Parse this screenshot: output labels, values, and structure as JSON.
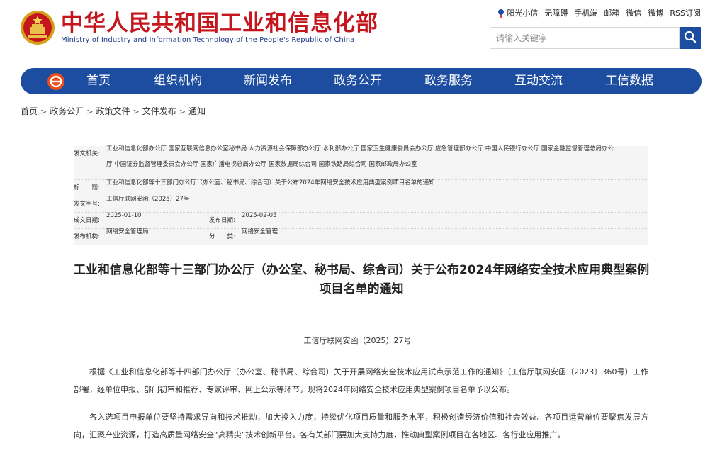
{
  "header": {
    "title_cn": "中华人民共和国工业和信息化部",
    "title_en": "Ministry of Industry and Information Technology of the People's Republic of China"
  },
  "top_links": [
    "阳光小信",
    "无障碍",
    "手机端",
    "邮箱",
    "微信",
    "微博",
    "RSS订阅"
  ],
  "search": {
    "placeholder": "请输入关键字"
  },
  "nav": {
    "items": [
      "首页",
      "组织机构",
      "新闻发布",
      "政务公开",
      "政务服务",
      "互动交流",
      "工信数据"
    ]
  },
  "breadcrumb": [
    "首页",
    "政务公开",
    "政策文件",
    "文件发布",
    "通知"
  ],
  "info": {
    "issuer_label": "发文机关:",
    "issuer_line1": "工业和信息化部办公厅 国家互联网信息办公室秘书局 人力资源社会保障部办公厅 水利部办公厅 国家卫生健康委员会办公厅 应急管理部办公厅 中国人民银行办公厅 国家金融监督管理总局办公",
    "issuer_line2": "厅 中国证券监督管理委员会办公厅 国家广播电视总局办公厅 国家数据局综合司 国家铁路局综合司 国家邮政局办公室",
    "title_label": "标　　题:",
    "title_value": "工业和信息化部等十三部门办公厅（办公室、秘书局、综合司）关于公布2024年网络安全技术应用典型案例项目名单的通知",
    "docno_label": "发文字号:",
    "docno_value": "工信厅联网安函（2025）27号",
    "created_label": "成文日期:",
    "created_value": "2025-01-10",
    "published_label": "发布日期:",
    "published_value": "2025-02-05",
    "org_label": "发布机构:",
    "org_value": "网络安全管理局",
    "category_label": "分　　类:",
    "category_value": "网络安全管理"
  },
  "article": {
    "title": "工业和信息化部等十三部门办公厅（办公室、秘书局、综合司）关于公布2024年网络安全技术应用典型案例项目名单的通知",
    "doc_number": "工信厅联网安函（2025）27号",
    "para1": "根据《工业和信息化部等十四部门办公厅（办公室、秘书局、综合司）关于开展网络安全技术应用试点示范工作的通知》（工信厅联网安函〔2023〕360号）工作部署，经单位申报、部门初审和推荐、专家评审、网上公示等环节，现将2024年网络安全技术应用典型案例项目名单予以公布。",
    "para2": "各入选项目申报单位要坚持需求导向和技术推动，加大投入力度，持续优化项目质量和服务水平，积极创造经济价值和社会效益。各项目运营单位要聚焦发展方向，汇聚产业资源，打造高质量网络安全“高精尖”技术创新平台。各有关部门要加大支持力度，推动典型案例项目在各地区、各行业应用推广。"
  },
  "colors": {
    "brand_red": "#c4161c",
    "nav_blue": "#1c4da1"
  }
}
